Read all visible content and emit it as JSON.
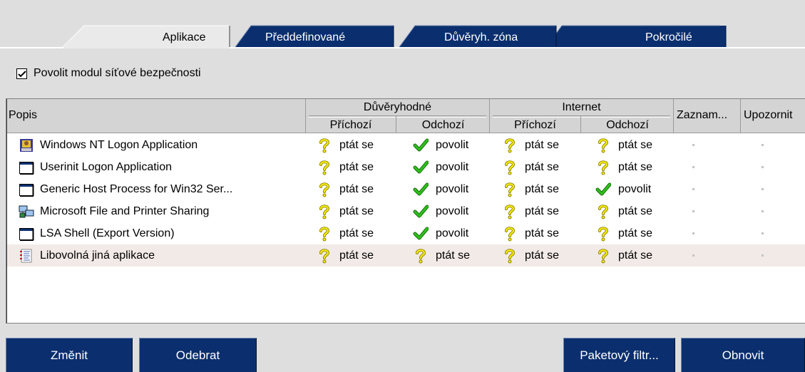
{
  "tabs": [
    {
      "label": "Aplikace",
      "active": true
    },
    {
      "label": "Předdefinované",
      "active": false
    },
    {
      "label": "Důvěryh. zóna",
      "active": false
    },
    {
      "label": "Pokročilé",
      "active": false
    }
  ],
  "checkbox": {
    "label": "Povolit modul síťové bezpečnosti",
    "checked": true
  },
  "table": {
    "columns": {
      "popis": "Popis",
      "trusted_group": "Důvěryhodné",
      "internet_group": "Internet",
      "incoming": "Příchozí",
      "outgoing": "Odchozí",
      "log": "Zaznam...",
      "notify": "Upozornit"
    },
    "rows": [
      {
        "name": "Windows NT Logon Application",
        "icon": "logon-app-icon",
        "trusted_in": "ptát se",
        "trusted_out": "povolit",
        "inet_in": "ptát se",
        "inet_out": "ptát se",
        "log": "·",
        "notify": "·"
      },
      {
        "name": "Userinit Logon Application",
        "icon": "window-app-icon",
        "trusted_in": "ptát se",
        "trusted_out": "povolit",
        "inet_in": "ptát se",
        "inet_out": "ptát se",
        "log": "·",
        "notify": "·"
      },
      {
        "name": "Generic Host Process for Win32 Ser...",
        "icon": "window-app-icon",
        "trusted_in": "ptát se",
        "trusted_out": "povolit",
        "inet_in": "ptát se",
        "inet_out": "povolit",
        "log": "·",
        "notify": "·"
      },
      {
        "name": "Microsoft File and Printer Sharing",
        "icon": "network-sharing-icon",
        "trusted_in": "ptát se",
        "trusted_out": "povolit",
        "inet_in": "ptát se",
        "inet_out": "ptát se",
        "log": "·",
        "notify": "·"
      },
      {
        "name": "LSA Shell (Export Version)",
        "icon": "window-app-icon",
        "trusted_in": "ptát se",
        "trusted_out": "povolit",
        "inet_in": "ptát se",
        "inet_out": "ptát se",
        "log": "·",
        "notify": "·"
      },
      {
        "name": "Libovolná jiná aplikace",
        "icon": "any-app-list-icon",
        "trusted_in": "ptát se",
        "trusted_out": "ptát se",
        "inet_in": "ptát se",
        "inet_out": "ptát se",
        "log": "·",
        "notify": "·"
      }
    ]
  },
  "buttons": {
    "change": "Změnit",
    "remove": "Odebrat",
    "packet_filter": "Paketový filtr...",
    "refresh": "Obnovit"
  },
  "colors": {
    "dark_tab": "#0b2f6e",
    "active_tab": "#eaeaea",
    "button": "#0b2f6e",
    "selected_row": "#f2eae6",
    "check_green": "#2aa21a",
    "question_yellow": "#f4ea10"
  }
}
